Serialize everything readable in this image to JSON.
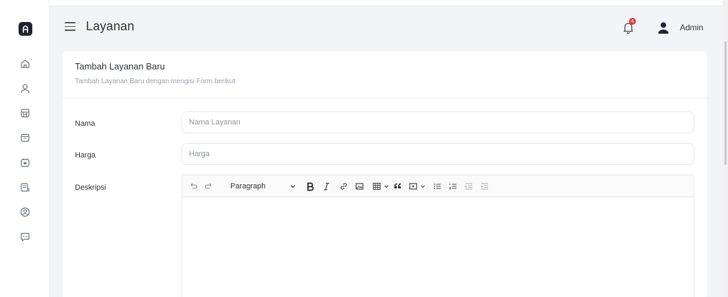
{
  "header": {
    "title": "Layanan",
    "notification_count": "4",
    "user_name": "Admin"
  },
  "sidebar": {
    "items": [
      {
        "icon": "home-icon"
      },
      {
        "icon": "user-icon"
      },
      {
        "icon": "store-icon"
      },
      {
        "icon": "inbox-icon"
      },
      {
        "icon": "calendar-icon"
      },
      {
        "icon": "receipt-icon"
      },
      {
        "icon": "account-circle-icon"
      },
      {
        "icon": "chat-icon"
      }
    ]
  },
  "form": {
    "title": "Tambah Layanan Baru",
    "subtitle": "Tambah Layanan Baru dengan mengisi Form berikut",
    "fields": {
      "nama": {
        "label": "Nama",
        "placeholder": "Nama Layanan",
        "value": ""
      },
      "harga": {
        "label": "Harga",
        "placeholder": "Harga",
        "value": ""
      },
      "deskripsi": {
        "label": "Deskripsi"
      }
    },
    "editor": {
      "heading_select": "Paragraph"
    }
  },
  "colors": {
    "notification_badge": "#e53935",
    "logo_bg": "#1f2230"
  }
}
